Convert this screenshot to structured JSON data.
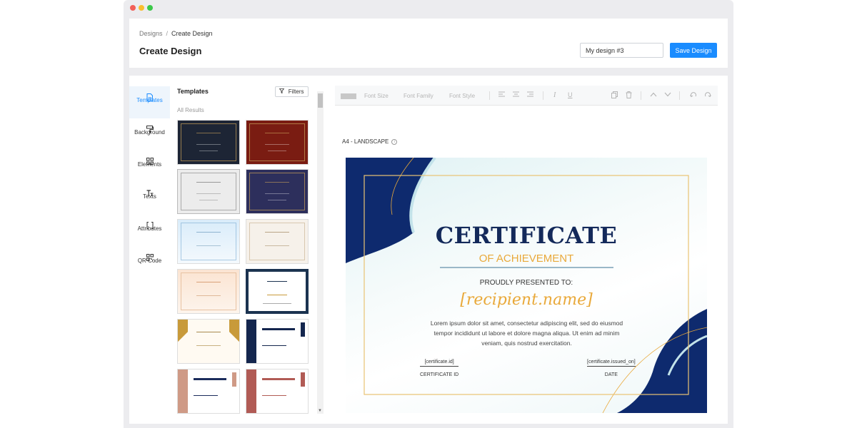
{
  "breadcrumb": {
    "root": "Designs",
    "separator": "/",
    "current": "Create Design"
  },
  "page_title": "Create Design",
  "design_name": "My design #3",
  "save_label": "Save Design",
  "sidebar": {
    "items": [
      {
        "label": "Templates",
        "icon": "document-icon",
        "active": true
      },
      {
        "label": "Background",
        "icon": "paint-roller-icon",
        "active": false
      },
      {
        "label": "Elements",
        "icon": "grid-icon",
        "active": false
      },
      {
        "label": "Texts",
        "icon": "text-icon",
        "active": false
      },
      {
        "label": "Attributes",
        "icon": "brackets-icon",
        "active": false
      },
      {
        "label": "QR Code",
        "icon": "qr-code-icon",
        "active": false
      }
    ]
  },
  "templates": {
    "title": "Templates",
    "filters_label": "Filters",
    "results_label": "All Results"
  },
  "toolbar": {
    "font_size": "Font Size",
    "font_family": "Font Family",
    "font_style": "Font Style"
  },
  "paper_label": "A4 - LANDSCAPE",
  "certificate": {
    "title": "CERTIFICATE",
    "subtitle": "OF ACHIEVEMENT",
    "presented": "PROUDLY PRESENTED TO:",
    "recipient": "[recipient.name]",
    "body": "Lorem ipsum dolor sit amet, consectetur adipiscing elit, sed do eiusmod tempor incididunt ut labore et dolore magna aliqua. Ut enim ad minim veniam, quis nostrud exercitation.",
    "id_value": "[certificate.id]",
    "id_caption": "CERTIFICATE ID",
    "date_value": "[certificate.issued_on]",
    "date_caption": "DATE"
  },
  "colors": {
    "accent": "#1a8cff",
    "navy": "#13295a",
    "gold": "#e9a93a"
  }
}
